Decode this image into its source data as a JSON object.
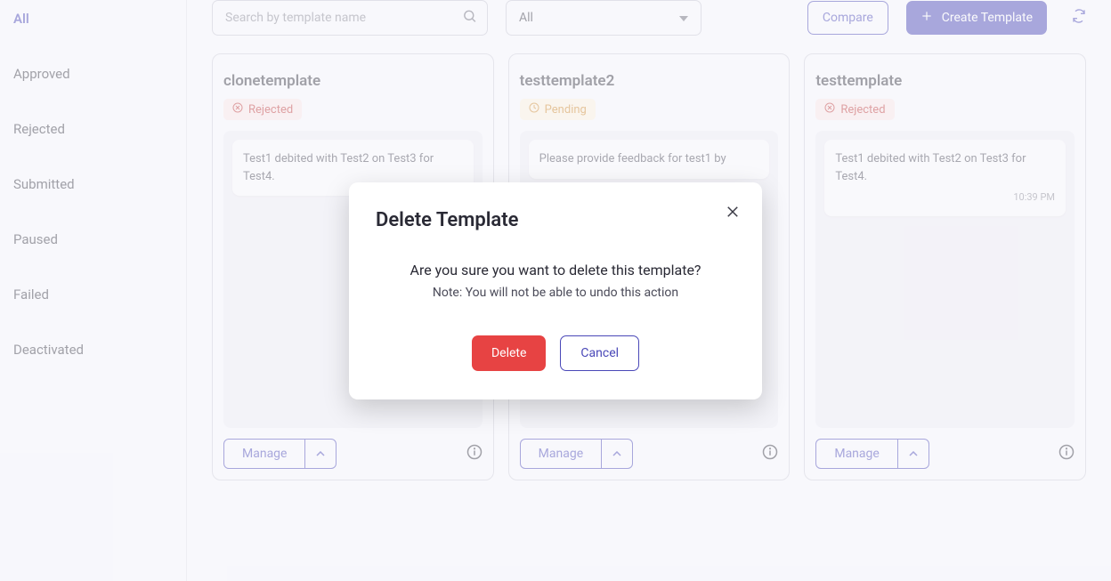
{
  "sidebar": {
    "items": [
      {
        "label": "All",
        "active": true
      },
      {
        "label": "Approved",
        "active": false
      },
      {
        "label": "Rejected",
        "active": false
      },
      {
        "label": "Submitted",
        "active": false
      },
      {
        "label": "Paused",
        "active": false
      },
      {
        "label": "Failed",
        "active": false
      },
      {
        "label": "Deactivated",
        "active": false
      }
    ]
  },
  "toolbar": {
    "search_placeholder": "Search by template name",
    "filter_value": "All",
    "compare_label": "Compare",
    "create_label": "Create Template"
  },
  "cards": [
    {
      "title": "clonetemplate",
      "status": "Rejected",
      "status_kind": "rejected",
      "bubble": "Test1 debited with Test2 on Test3 for Test4.",
      "time": "",
      "manage_label": "Manage"
    },
    {
      "title": "testtemplate2",
      "status": "Pending",
      "status_kind": "pending",
      "bubble": "Please provide feedback for test1 by",
      "time": "",
      "manage_label": "Manage"
    },
    {
      "title": "testtemplate",
      "status": "Rejected",
      "status_kind": "rejected",
      "bubble": "Test1 debited with Test2 on Test3 for Test4.",
      "time": "10:39 PM",
      "manage_label": "Manage"
    }
  ],
  "modal": {
    "title": "Delete Template",
    "message": "Are you sure you want to delete this template?",
    "note": "Note: You will not be able to undo this action",
    "delete_label": "Delete",
    "cancel_label": "Cancel"
  }
}
